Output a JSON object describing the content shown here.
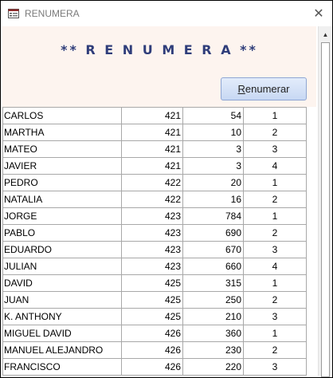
{
  "window": {
    "title": "RENUMERA",
    "close_glyph": "✕"
  },
  "form": {
    "title": "** R E N U M E R A **"
  },
  "button": {
    "accesskey": "R",
    "rest": "enumerar"
  },
  "scrollbar": {
    "up_glyph": "▲"
  },
  "rows": [
    {
      "name": "CARLOS",
      "code": "421",
      "num": "54",
      "ord": "1"
    },
    {
      "name": "MARTHA",
      "code": "421",
      "num": "10",
      "ord": "2"
    },
    {
      "name": "MATEO",
      "code": "421",
      "num": "3",
      "ord": "3"
    },
    {
      "name": "JAVIER",
      "code": "421",
      "num": "3",
      "ord": "4"
    },
    {
      "name": "PEDRO",
      "code": "422",
      "num": "20",
      "ord": "1"
    },
    {
      "name": "NATALIA",
      "code": "422",
      "num": "16",
      "ord": "2"
    },
    {
      "name": "JORGE",
      "code": "423",
      "num": "784",
      "ord": "1"
    },
    {
      "name": "PABLO",
      "code": "423",
      "num": "690",
      "ord": "2"
    },
    {
      "name": "EDUARDO",
      "code": "423",
      "num": "670",
      "ord": "3"
    },
    {
      "name": "JULIAN",
      "code": "423",
      "num": "660",
      "ord": "4"
    },
    {
      "name": "DAVID",
      "code": "425",
      "num": "315",
      "ord": "1"
    },
    {
      "name": "JUAN",
      "code": "425",
      "num": "250",
      "ord": "2"
    },
    {
      "name": "K. ANTHONY",
      "code": "425",
      "num": "210",
      "ord": "3"
    },
    {
      "name": "MIGUEL DAVID",
      "code": "426",
      "num": "360",
      "ord": "1"
    },
    {
      "name": "MANUEL ALEJANDRO",
      "code": "426",
      "num": "230",
      "ord": "2"
    },
    {
      "name": "FRANCISCO",
      "code": "426",
      "num": "220",
      "ord": "3"
    }
  ]
}
